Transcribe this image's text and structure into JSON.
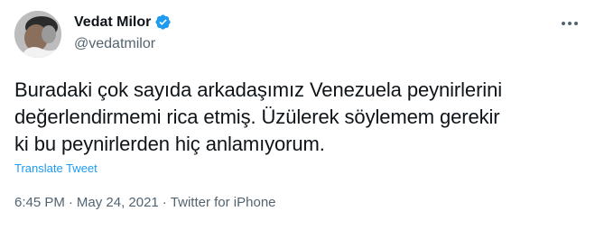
{
  "author": {
    "display_name": "Vedat Milor",
    "handle": "@vedatmilor",
    "verified_icon": "verified-badge-icon",
    "avatar_icon": "avatar-photo"
  },
  "tweet": {
    "text": "Buradaki çok sayıda arkadaşımız Venezuela peynirlerini\ndeğerlendirmemi rica etmiş. Üzülerek söylemem gerekir\nki bu peynirlerden hiç anlamıyorum.",
    "translate_label": "Translate Tweet"
  },
  "meta": {
    "time": "6:45 PM",
    "separator": "·",
    "date": "May 24, 2021",
    "source": "Twitter for iPhone"
  },
  "menu": {
    "icon": "more-options-icon"
  },
  "colors": {
    "accent": "#1d9bf0",
    "text": "#0f1419",
    "secondary": "#536471"
  }
}
